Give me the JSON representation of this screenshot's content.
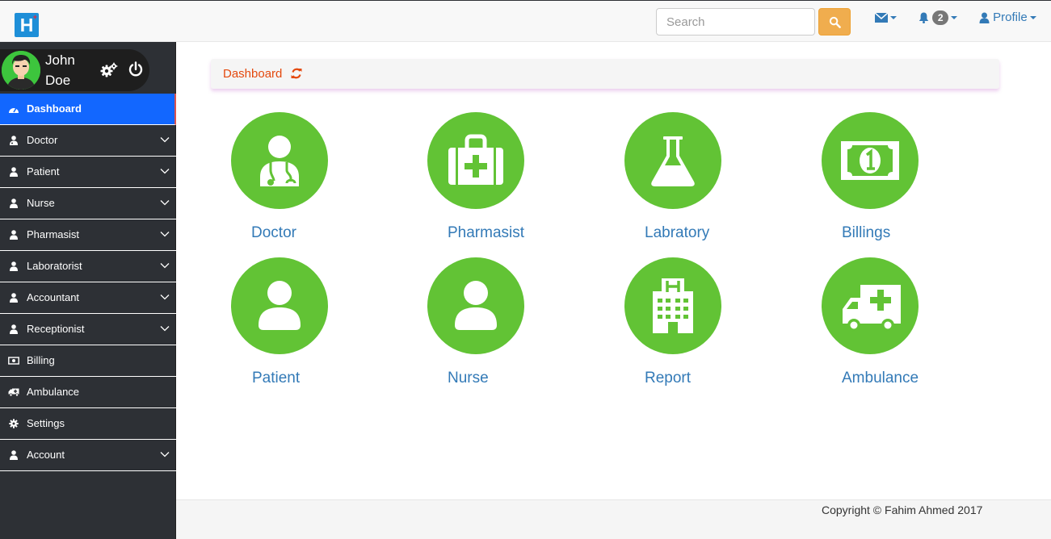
{
  "app": {
    "logo_letter": "H",
    "logo_plus": "+"
  },
  "header": {
    "search_placeholder": "Search",
    "notification_count": "2",
    "profile_label": "Profile"
  },
  "user": {
    "first_name": "John",
    "last_name": "Doe"
  },
  "sidebar": {
    "items": [
      {
        "label": "Dashboard",
        "icon": "dashboard-icon",
        "expandable": false,
        "active": true
      },
      {
        "label": "Doctor",
        "icon": "user-md-icon",
        "expandable": true
      },
      {
        "label": "Patient",
        "icon": "user-icon",
        "expandable": true
      },
      {
        "label": "Nurse",
        "icon": "user-icon",
        "expandable": true
      },
      {
        "label": "Pharmasist",
        "icon": "user-icon",
        "expandable": true
      },
      {
        "label": "Laboratorist",
        "icon": "user-icon",
        "expandable": true
      },
      {
        "label": "Accountant",
        "icon": "user-icon",
        "expandable": true
      },
      {
        "label": "Receptionist",
        "icon": "user-icon",
        "expandable": true
      },
      {
        "label": "Billing",
        "icon": "money-icon",
        "expandable": false
      },
      {
        "label": "Ambulance",
        "icon": "ambulance-icon",
        "expandable": false
      },
      {
        "label": "Settings",
        "icon": "gear-icon",
        "expandable": false
      },
      {
        "label": "Account",
        "icon": "user-icon",
        "expandable": true
      }
    ]
  },
  "breadcrumb": {
    "title": "Dashboard"
  },
  "tiles": [
    {
      "label": "Doctor",
      "icon": "doctor-icon"
    },
    {
      "label": "Pharmasist",
      "icon": "medkit-icon"
    },
    {
      "label": "Labratory",
      "icon": "flask-icon"
    },
    {
      "label": "Billings",
      "icon": "money-bill-icon"
    },
    {
      "label": "Patient",
      "icon": "patient-icon"
    },
    {
      "label": "Nurse",
      "icon": "nurse-icon"
    },
    {
      "label": "Report",
      "icon": "hospital-icon"
    },
    {
      "label": "Ambulance",
      "icon": "ambulance-icon"
    }
  ],
  "footer": {
    "copyright": "Copyright © Fahim Ahmed 2017"
  },
  "colors": {
    "sidebar_bg": "#2d3035",
    "active_item": "#1267ff",
    "tile_green": "#62c335",
    "link_blue": "#337ab7",
    "search_button": "#f0ad4e",
    "breadcrumb_text": "#e4490e"
  }
}
